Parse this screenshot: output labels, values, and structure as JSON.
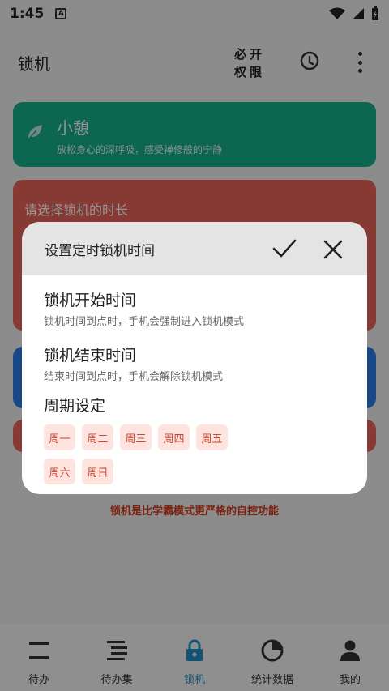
{
  "status": {
    "time": "1:45",
    "notif_letter": "A"
  },
  "appbar": {
    "title": "锁机",
    "perm_line1": "必开",
    "perm_line2": "权限"
  },
  "cards": {
    "rest": {
      "title": "小憩",
      "subtitle": "放松身心的深呼吸，感受禅修般的宁静"
    },
    "duration": {
      "title": "请选择锁机的时长"
    }
  },
  "lock_note": "锁机是比学霸模式更严格的自控功能",
  "nav": {
    "items": [
      {
        "label": "待办"
      },
      {
        "label": "待办集"
      },
      {
        "label": "锁机"
      },
      {
        "label": "统计数据"
      },
      {
        "label": "我的"
      }
    ]
  },
  "dialog": {
    "title": "设置定时锁机时间",
    "start": {
      "title": "锁机开始时间",
      "subtitle": "锁机时间到点时，手机会强制进入锁机模式"
    },
    "end": {
      "title": "锁机结束时间",
      "subtitle": "结束时间到点时，手机会解除锁机模式"
    },
    "cycle": {
      "title": "周期设定"
    },
    "days": [
      "周一",
      "周二",
      "周三",
      "周四",
      "周五",
      "周六",
      "周日"
    ]
  },
  "colors": {
    "green": "#16b08a",
    "red": "#e8655a",
    "blue": "#2d7de8",
    "accent": "#1c8fc5",
    "chip_bg": "#fde4de",
    "chip_text": "#c9452f"
  }
}
